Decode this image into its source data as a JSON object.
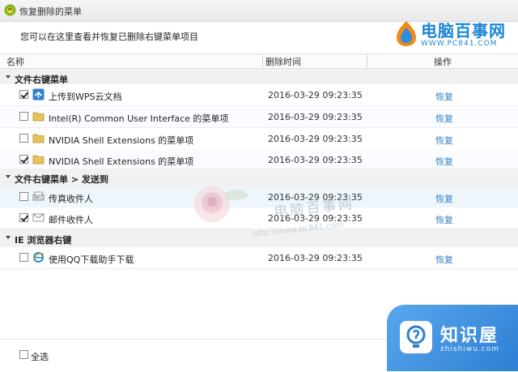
{
  "window": {
    "title": "恢复删除的菜单"
  },
  "header": {
    "description": "您可以在这里查看并恢复已删除右键菜单项目"
  },
  "brand_watermark": {
    "name": "电脑百事网",
    "url": "WWW.PC841.COM"
  },
  "table": {
    "columns": [
      "名称",
      "删除时间",
      "操作"
    ],
    "groups": [
      {
        "label": "文件右键菜单",
        "rows": [
          {
            "checked": true,
            "icon": "wps-cloud-icon",
            "name": "上传到WPS云文档",
            "time": "2016-03-29 09:23:35",
            "action": "恢复"
          },
          {
            "checked": false,
            "icon": "folder-icon",
            "name": "Intel(R) Common User Interface 的菜单项",
            "time": "2016-03-29 09:23:35",
            "action": "恢复"
          },
          {
            "checked": false,
            "icon": "folder-icon",
            "name": "NVIDIA Shell Extensions 的菜单项",
            "time": "2016-03-29 09:23:35",
            "action": "恢复"
          },
          {
            "checked": true,
            "icon": "folder-icon",
            "name": "NVIDIA Shell Extensions 的菜单项",
            "time": "2016-03-29 09:23:35",
            "action": "恢复"
          }
        ]
      },
      {
        "label": "文件右键菜单 > 发送到",
        "rows": [
          {
            "checked": false,
            "icon": "fax-icon",
            "name": "传真收件人",
            "time": "2016-03-29 09:23:35",
            "action": "恢复"
          },
          {
            "checked": true,
            "icon": "mail-icon",
            "name": "邮件收件人",
            "time": "2016-03-29 09:23:35",
            "action": "恢复"
          }
        ]
      },
      {
        "label": "IE 浏览器右键",
        "rows": [
          {
            "checked": false,
            "icon": "ie-icon",
            "name": "使用QQ下载助手下载",
            "time": "2016-03-29 09:23:35",
            "action": "恢复"
          }
        ]
      }
    ]
  },
  "center_watermark": {
    "text": "电脑百事网",
    "url": "http://www.pc841.com"
  },
  "footer": {
    "select_all_label": "全选",
    "select_all_checked": false
  },
  "corner_watermark": {
    "name": "知识屋",
    "url": "zhishiwu.com"
  }
}
